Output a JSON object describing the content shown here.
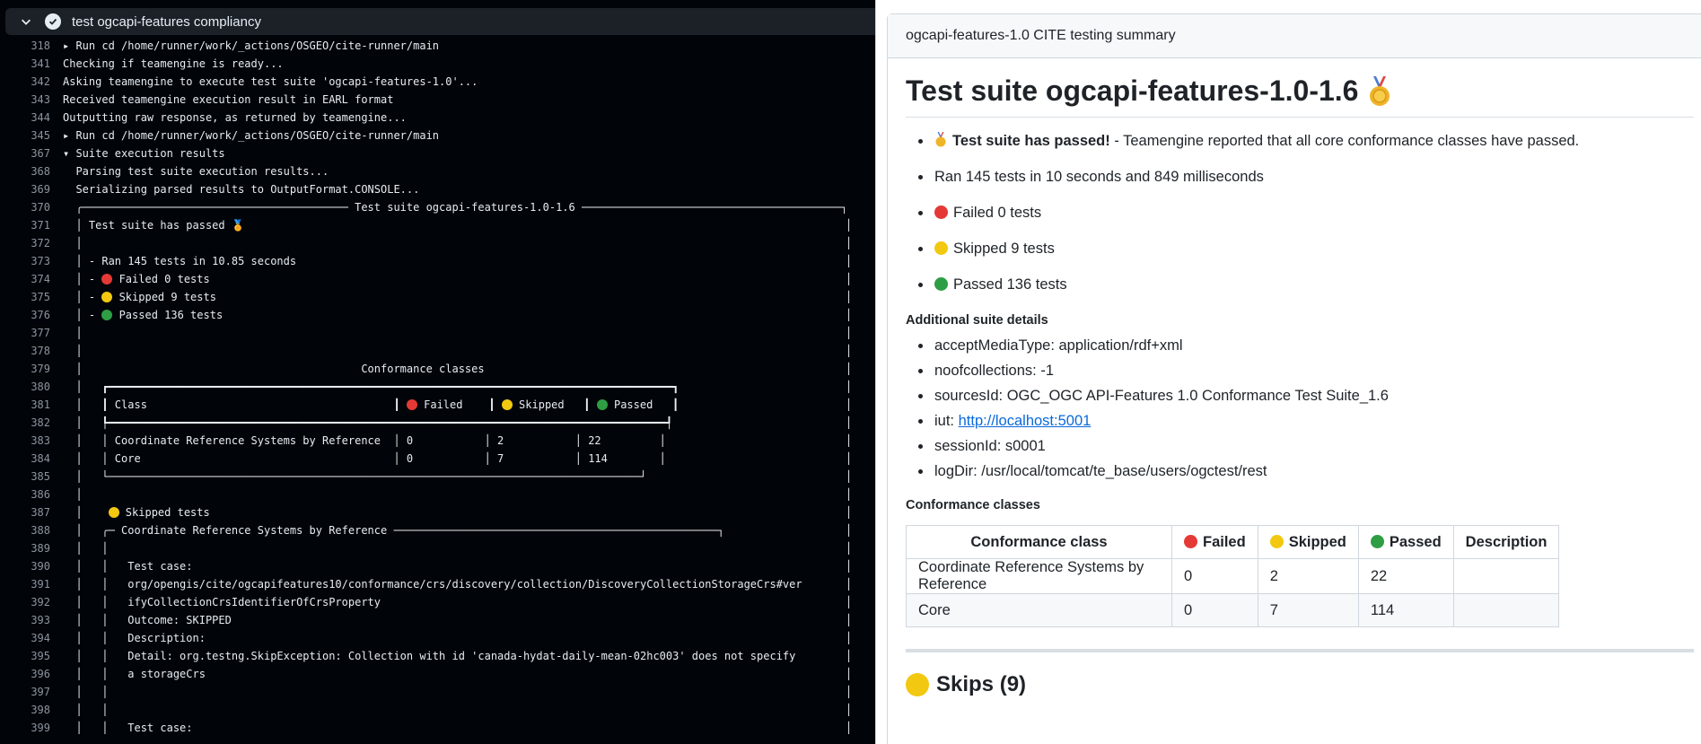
{
  "step": {
    "title": "test ogcapi-features compliancy"
  },
  "log": [
    {
      "n": "318",
      "t": "▸ Run cd /home/runner/work/_actions/OSGEO/cite-runner/main"
    },
    {
      "n": "341",
      "t": "Checking if teamengine is ready..."
    },
    {
      "n": "342",
      "t": "Asking teamengine to execute test suite 'ogcapi-features-1.0'..."
    },
    {
      "n": "343",
      "t": "Received teamengine execution result in EARL format"
    },
    {
      "n": "344",
      "t": "Outputting raw response, as returned by teamengine..."
    },
    {
      "n": "345",
      "t": "▸ Run cd /home/runner/work/_actions/OSGEO/cite-runner/main"
    },
    {
      "n": "367",
      "t": "▾ Suite execution results"
    },
    {
      "n": "368",
      "t": "  Parsing test suite execution results..."
    },
    {
      "n": "369",
      "t": "  Serializing parsed results to OutputFormat.CONSOLE..."
    },
    {
      "n": "370",
      "t": "  ╭───────────────────────────────────────── Test suite ogcapi-features-1.0-1.6 ────────────────────────────────────────┐"
    },
    {
      "n": "371",
      "t": "  │ Test suite has passed 🏅",
      "pad": true
    },
    {
      "n": "372",
      "t": "  │",
      "pad": true
    },
    {
      "n": "373",
      "t": "  │ - Ran 145 tests in 10.85 seconds",
      "pad": true
    },
    {
      "n": "374",
      "t": "  │ - ",
      "icon": "red",
      "after": " Failed 0 tests",
      "pad": true
    },
    {
      "n": "375",
      "t": "  │ - ",
      "icon": "yel",
      "after": " Skipped 9 tests",
      "pad": true
    },
    {
      "n": "376",
      "t": "  │ - ",
      "icon": "grn",
      "after": " Passed 136 tests",
      "pad": true
    },
    {
      "n": "377",
      "t": "  │",
      "pad": true
    },
    {
      "n": "378",
      "t": "  │",
      "pad": true
    },
    {
      "n": "379",
      "t": "  │                                           Conformance classes",
      "pad": true
    },
    {
      "n": "380",
      "t": "  │   ┏━━━━━━━━━━━━━━━━━━━━━━━━━━━━━━━━━━━━━━━━━━━━━━━━━━━━━━━━━━━━━━━━━━━━━━━━━━━━━━━━━━━━━━━┓",
      "pad": true
    },
    {
      "n": "381",
      "t": "  │   ┃ Class                                      ┃ ",
      "icon": "red",
      "after": " Failed    ┃ ",
      "icon2": "yel",
      "after2": " Skipped   ┃ ",
      "icon3": "grn",
      "after3": " Passed   ┃",
      "pad": true
    },
    {
      "n": "382",
      "t": "  │   ┡━━━━━━━━━━━━━━━━━━━━━━━━━━━━━━━━━━━━━━━━━━━━━━━━━━━━━━━━━━━━━━━━━━━━━━━━━━━━━━━━━━━━━━┩",
      "pad": true
    },
    {
      "n": "383",
      "t": "  │   │ Coordinate Reference Systems by Reference  │ 0           │ 2           │ 22         │",
      "pad": true
    },
    {
      "n": "384",
      "t": "  │   │ Core                                       │ 0           │ 7           │ 114        │",
      "pad": true
    },
    {
      "n": "385",
      "t": "  │   └──────────────────────────────────────────────────────────────────────────────────┘",
      "pad": true
    },
    {
      "n": "386",
      "t": "  │",
      "pad": true
    },
    {
      "n": "387",
      "t": "  │    ",
      "icon": "yel",
      "after": " Skipped tests",
      "pad": true
    },
    {
      "n": "388",
      "t": "  │   ╭─ Coordinate Reference Systems by Reference ──────────────────────────────────────────────────┐",
      "pad": true
    },
    {
      "n": "389",
      "t": "  │   │",
      "pad": true
    },
    {
      "n": "390",
      "t": "  │   │   Test case:",
      "pad": true
    },
    {
      "n": "391",
      "t": "  │   │   org/opengis/cite/ogcapifeatures10/conformance/crs/discovery/collection/DiscoveryCollectionStorageCrs#ver",
      "pad": true
    },
    {
      "n": "392",
      "t": "  │   │   ifyCollectionCrsIdentifierOfCrsProperty",
      "pad": true
    },
    {
      "n": "393",
      "t": "  │   │   Outcome: SKIPPED",
      "pad": true
    },
    {
      "n": "394",
      "t": "  │   │   Description:",
      "pad": true
    },
    {
      "n": "395",
      "t": "  │   │   Detail: org.testng.SkipException: Collection with id 'canada-hydat-daily-mean-02hc003' does not specify",
      "pad": true
    },
    {
      "n": "396",
      "t": "  │   │   a storageCrs",
      "pad": true
    },
    {
      "n": "397",
      "t": "  │   │",
      "pad": true
    },
    {
      "n": "398",
      "t": "  │   │",
      "pad": true
    },
    {
      "n": "399",
      "t": "  │   │   Test case:",
      "pad": true
    }
  ],
  "summary": {
    "header": "ogcapi-features-1.0 CITE testing summary",
    "title": "Test suite ogcapi-features-1.0-1.6",
    "passed_bold": "Test suite has passed!",
    "passed_rest": " - Teamengine reported that all core conformance classes have passed.",
    "ran": "Ran 145 tests in 10 seconds and 849 milliseconds",
    "failed": "Failed 0 tests",
    "skipped": "Skipped 9 tests",
    "passed": "Passed 136 tests",
    "details_heading": "Additional suite details",
    "details": {
      "accept": "acceptMediaType: application/rdf+xml",
      "noof": "noofcollections: -1",
      "sources": "sourcesId: OGC_OGC API-Features 1.0 Conformance Test Suite_1.6",
      "iut_label": "iut: ",
      "iut_link": "http://localhost:5001",
      "session": "sessionId: s0001",
      "logdir": "logDir: /usr/local/tomcat/te_base/users/ogctest/rest"
    },
    "conf_heading": "Conformance classes",
    "table": {
      "h_class": "Conformance class",
      "h_failed": "Failed",
      "h_skipped": "Skipped",
      "h_passed": "Passed",
      "h_desc": "Description",
      "rows": [
        {
          "cls": "Coordinate Reference Systems by Reference",
          "f": "0",
          "s": "2",
          "p": "22",
          "d": ""
        },
        {
          "cls": "Core",
          "f": "0",
          "s": "7",
          "p": "114",
          "d": ""
        }
      ]
    },
    "skips_heading": "Skips (9)"
  },
  "colors": {
    "failed": "#e53935",
    "skipped": "#f2c811",
    "passed": "#2e9e44",
    "terminal_bg": "#010409",
    "link": "#0969da"
  }
}
